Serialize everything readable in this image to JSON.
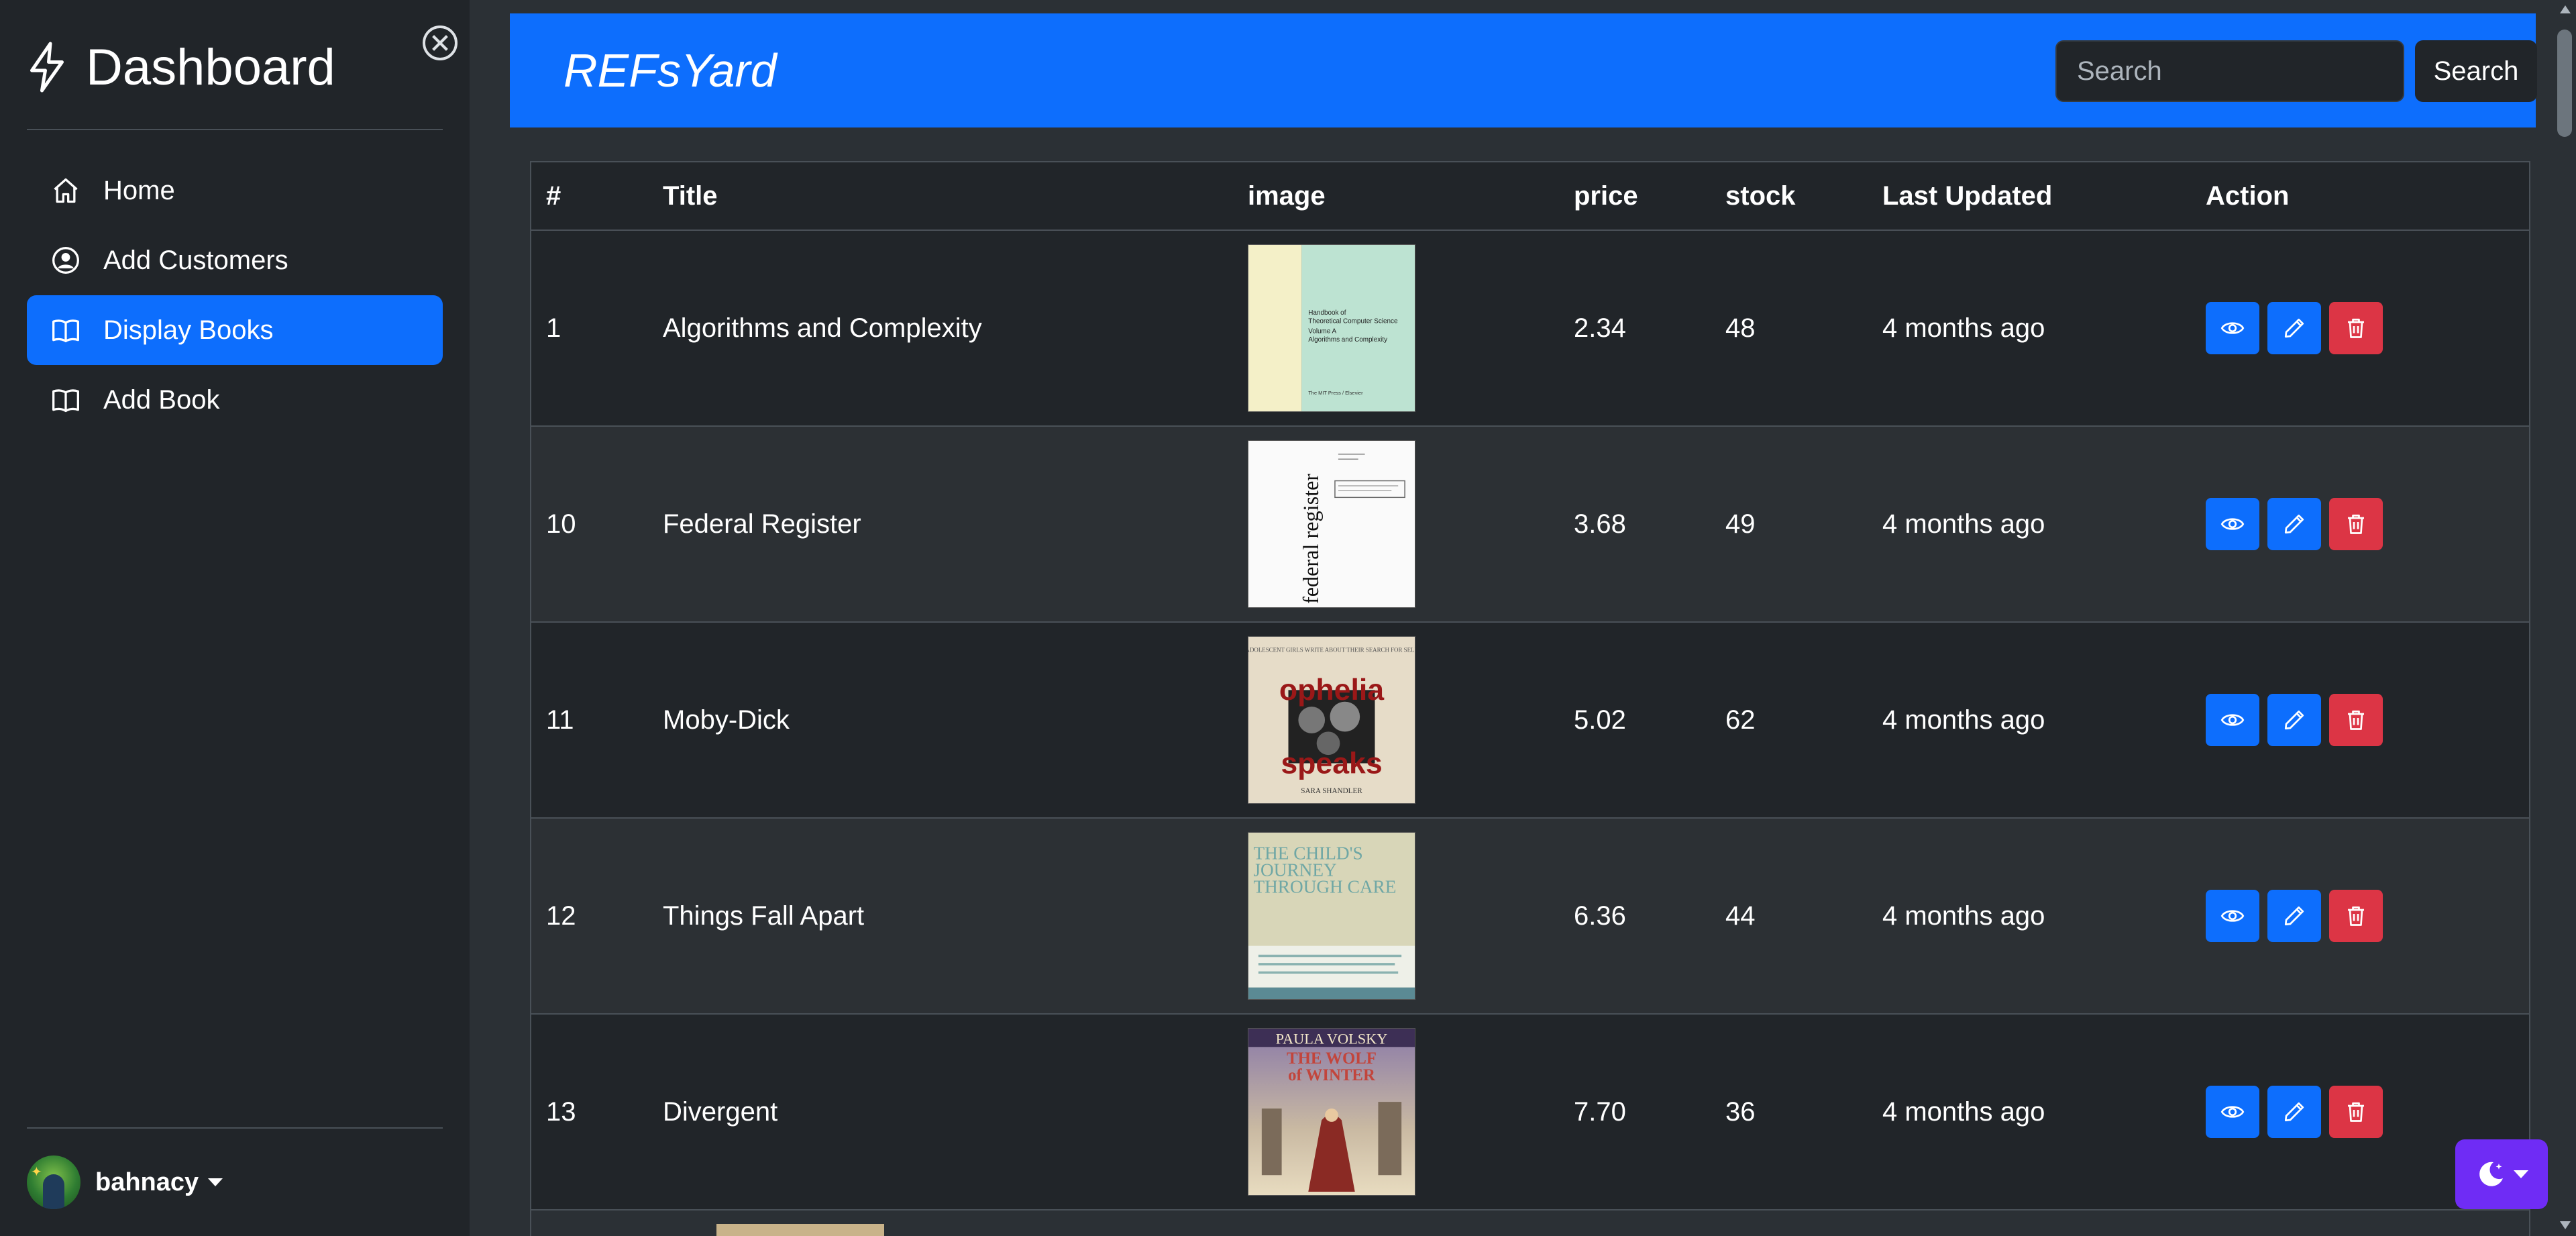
{
  "sidebar": {
    "brand": "Dashboard",
    "items": [
      {
        "label": "Home",
        "icon": "house-icon"
      },
      {
        "label": "Add Customers",
        "icon": "person-circle-icon"
      },
      {
        "label": "Display Books",
        "icon": "book-icon",
        "active": true
      },
      {
        "label": "Add Book",
        "icon": "book-icon"
      }
    ],
    "user": {
      "name": "bahnacy"
    }
  },
  "header": {
    "title": "REFsYard",
    "search_placeholder": "Search",
    "search_button": "Search"
  },
  "table": {
    "columns": [
      "#",
      "Title",
      "image",
      "price",
      "stock",
      "Last Updated",
      "Action"
    ],
    "rows": [
      {
        "id": "1",
        "title": "Algorithms and Complexity",
        "price": "2.34",
        "stock": "48",
        "updated": "4 months ago"
      },
      {
        "id": "10",
        "title": "Federal Register",
        "price": "3.68",
        "stock": "49",
        "updated": "4 months ago"
      },
      {
        "id": "11",
        "title": "Moby-Dick",
        "price": "5.02",
        "stock": "62",
        "updated": "4 months ago"
      },
      {
        "id": "12",
        "title": "Things Fall Apart",
        "price": "6.36",
        "stock": "44",
        "updated": "4 months ago"
      },
      {
        "id": "13",
        "title": "Divergent",
        "price": "7.70",
        "stock": "36",
        "updated": "4 months ago"
      }
    ]
  },
  "covers": {
    "c1": {
      "line1": "Handbook of",
      "line2": "Theoretical Computer Science",
      "line3": "Volume A",
      "line4": "Algorithms and Complexity",
      "footer": "The MIT Press / Elsevier"
    },
    "c2": {
      "spine": "federal register"
    },
    "c3": {
      "top": "ADOLESCENT GIRLS WRITE ABOUT THEIR SEARCH FOR SELF",
      "word1": "ophelia",
      "word2": "speaks",
      "author": "SARA SHANDLER"
    },
    "c4": {
      "title": "THE CHILD'S JOURNEY THROUGH CARE"
    },
    "c5": {
      "author": "PAULA VOLSKY",
      "title1": "THE WOLF",
      "title2": "of WINTER"
    }
  },
  "colors": {
    "primary": "#0d6efd",
    "danger": "#dc3545",
    "theme_toggle": "#6f2cf5",
    "bg_dark": "#212529"
  }
}
